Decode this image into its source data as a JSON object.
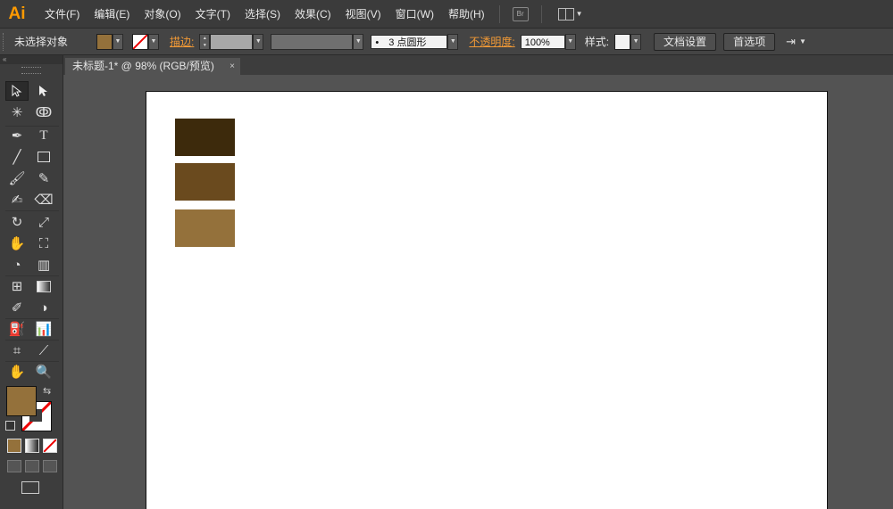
{
  "app": {
    "logo": "Ai"
  },
  "menu": [
    "文件(F)",
    "编辑(E)",
    "对象(O)",
    "文字(T)",
    "选择(S)",
    "效果(C)",
    "视图(V)",
    "窗口(W)",
    "帮助(H)"
  ],
  "menubar_icons": {
    "bridge": "Br"
  },
  "control": {
    "selection_label": "未选择对象",
    "fill_color": "#94713b",
    "stroke_label": "描边:",
    "brush_value": "3 点圆形",
    "opacity_label": "不透明度:",
    "opacity_value": "100%",
    "style_label": "样式:",
    "doc_setup_button": "文档设置",
    "prefs_button": "首选项"
  },
  "document": {
    "tab_title": "未标题-1* @ 98% (RGB/预览)",
    "close_glyph": "×"
  },
  "swatches": {
    "fill": "#94713b",
    "rect_colors": [
      "#3d2a0c",
      "#6a4a1e",
      "#94713b"
    ]
  },
  "tools": [
    "selection-tool",
    "direct-selection-tool",
    "magic-wand-tool",
    "lasso-tool",
    "pen-tool",
    "type-tool",
    "line-tool",
    "rectangle-tool",
    "paintbrush-tool",
    "pencil-tool",
    "blob-brush-tool",
    "eraser-tool",
    "rotate-tool",
    "scale-tool",
    "warp-tool",
    "free-transform-tool",
    "shape-builder-tool",
    "graph-tool",
    "mesh-tool",
    "gradient-tool",
    "eyedropper-tool",
    "blend-tool",
    "symbol-sprayer-tool",
    "column-graph-tool",
    "artboard-tool",
    "slice-tool",
    "hand-tool",
    "zoom-tool"
  ]
}
